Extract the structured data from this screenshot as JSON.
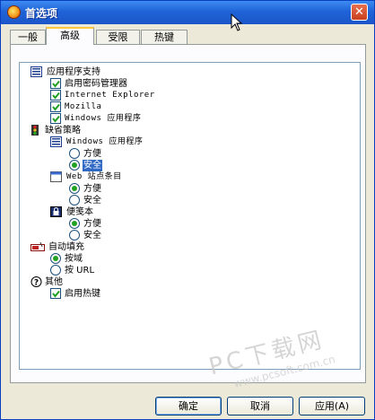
{
  "window": {
    "title": "首选项",
    "close_label": "✕"
  },
  "tabs": [
    {
      "label": "一般",
      "active": false
    },
    {
      "label": "高级",
      "active": true
    },
    {
      "label": "受限",
      "active": false
    },
    {
      "label": "热键",
      "active": false
    }
  ],
  "tree": {
    "app_support": {
      "label": "应用程序支持",
      "items": [
        {
          "label": "启用密码管理器",
          "checked": true
        },
        {
          "label": "Internet Explorer",
          "checked": true
        },
        {
          "label": "Mozilla",
          "checked": true
        },
        {
          "label": "Windows 应用程序",
          "checked": true
        }
      ]
    },
    "default_policy": {
      "label": "缺省策略",
      "windows_apps": {
        "label": "Windows 应用程序",
        "options": [
          {
            "label": "方便",
            "selected": false
          },
          {
            "label": "安全",
            "selected": true
          }
        ]
      },
      "web_sites": {
        "label": "Web 站点条目",
        "options": [
          {
            "label": "方便",
            "selected": true
          },
          {
            "label": "安全",
            "selected": false
          }
        ]
      },
      "notes": {
        "label": "便笺本",
        "options": [
          {
            "label": "方便",
            "selected": true
          },
          {
            "label": "安全",
            "selected": false
          }
        ]
      }
    },
    "autofill": {
      "label": "自动填充",
      "options": [
        {
          "label": "按域",
          "selected": true
        },
        {
          "label": "按 URL",
          "selected": false
        }
      ]
    },
    "other": {
      "label": "其他",
      "items": [
        {
          "label": "启用热键",
          "checked": true
        }
      ]
    }
  },
  "watermark": {
    "text": "PC下载网",
    "url": "www.pcsoft.com.cn"
  },
  "buttons": {
    "ok": "确定",
    "cancel": "取消",
    "apply": "应用(A)"
  },
  "colors": {
    "title_bar": "#1f63d8",
    "selection": "#316ac5",
    "check_green": "#21a121",
    "tab_highlight": "#ffc83c"
  }
}
